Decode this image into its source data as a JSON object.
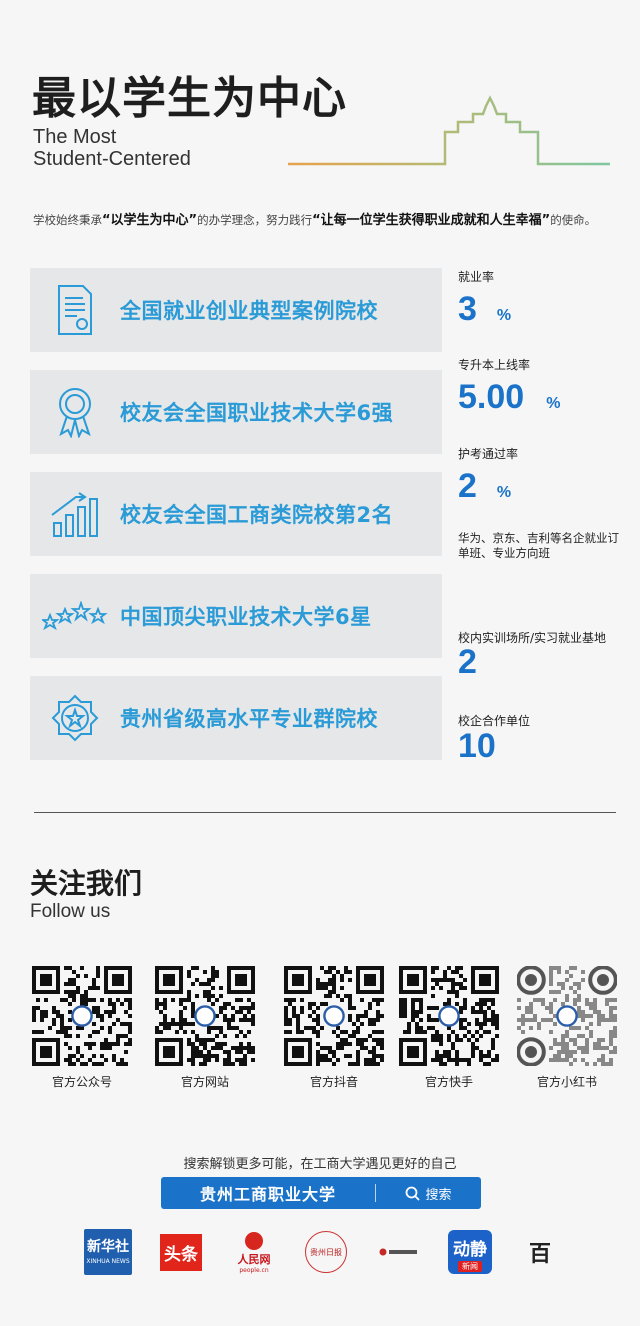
{
  "header": {
    "title": "最以学生为中心",
    "subtitle_line1": "The Most",
    "subtitle_line2": "Student-Centered"
  },
  "mission": {
    "part1": "学校始终秉承",
    "quote1": "“以学生为中心”",
    "part2": "的办学理念，努力践行",
    "quote2": "“让每一位学生获得职业成就和人生幸福”",
    "part3": "的使命。"
  },
  "honors": [
    {
      "label": "全国就业创业典型案例院校",
      "icon": "certificate-icon"
    },
    {
      "label": "校友会全国职业技术大学6强",
      "icon": "award-medal-icon"
    },
    {
      "label": "校友会全国工商类院校第2名",
      "icon": "bar-chart-growth-icon"
    },
    {
      "label": "中国顶尖职业技术大学6星",
      "icon": "stars-icon"
    },
    {
      "label": "贵州省级高水平专业群院校",
      "icon": "star-badge-icon"
    }
  ],
  "stats": {
    "employment": {
      "label": "就业率",
      "value": "3",
      "unit": "%"
    },
    "upgrade": {
      "label": "专升本上线率",
      "value": "5.00",
      "unit": "%"
    },
    "nursing": {
      "label": "护考通过率",
      "value": "2",
      "unit": "%"
    },
    "enterprise_note": "华为、京东、吉利等名企就业订单班、专业方向班",
    "training": {
      "label": "校内实训场所/实习就业基地",
      "value": "2"
    },
    "partners": {
      "label": "校企合作单位",
      "value": "10"
    }
  },
  "follow": {
    "title": "关注我们",
    "subtitle": "Follow us",
    "channels": [
      {
        "label": "官方公众号"
      },
      {
        "label": "官方网站"
      },
      {
        "label": "官方抖音"
      },
      {
        "label": "官方快手"
      },
      {
        "label": "官方小红书"
      }
    ]
  },
  "search": {
    "slogan": "搜索解锁更多可能，在工商大学遇见更好的自己",
    "query": "贵州工商职业大学",
    "button": "搜索"
  },
  "media": {
    "xinhua": "新华社",
    "xinhua_en": "XINHUA NEWS",
    "toutiao": "头条",
    "people": "人民网",
    "people_en": "people.cn",
    "guizhou_daily": "贵州日报",
    "dongjing": "动静",
    "dongjing_sub": "新闻",
    "baijia": "百"
  },
  "colors": {
    "accent_blue": "#1a73c9",
    "card_text": "#2a9bd6",
    "card_bg": "#e6e7e9"
  }
}
